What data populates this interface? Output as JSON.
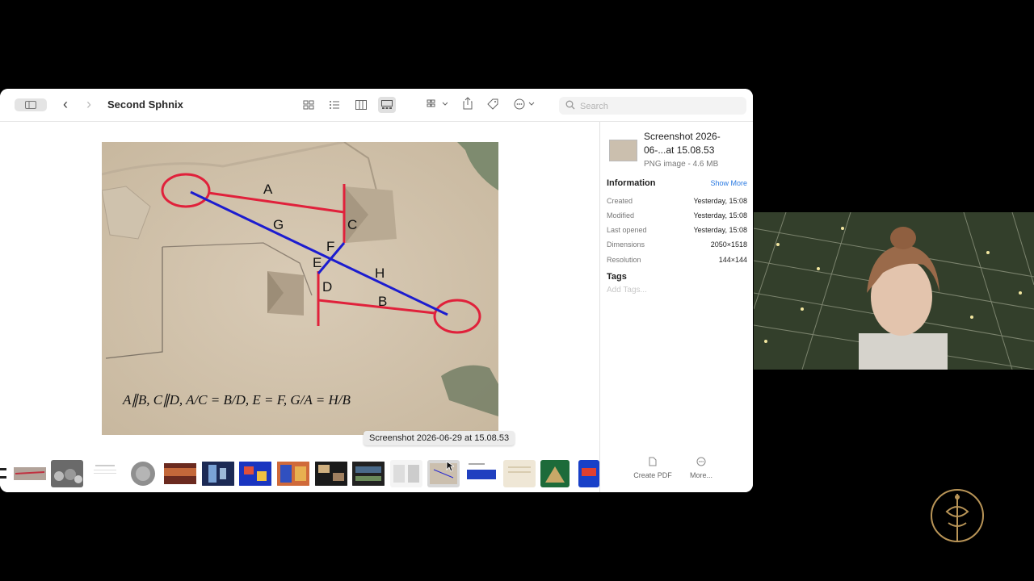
{
  "window": {
    "title": "Second Sphnix",
    "search_placeholder": "Search"
  },
  "preview": {
    "labels": [
      "A",
      "G",
      "C",
      "F",
      "E",
      "H",
      "D",
      "B"
    ],
    "formula": "A∥B, C∥D, A/C = B/D, E = F, G/A = H/B"
  },
  "tooltip": "Screenshot 2026-06-29 at 15.08.53",
  "info": {
    "file_name": "Screenshot 2026-06-...at 15.08.53",
    "file_type": "PNG image - 4.6 MB",
    "section_title": "Information",
    "show_more": "Show More",
    "rows": [
      {
        "label": "Created",
        "value": "Yesterday, 15:08"
      },
      {
        "label": "Modified",
        "value": "Yesterday, 15:08"
      },
      {
        "label": "Last opened",
        "value": "Yesterday, 15:08"
      },
      {
        "label": "Dimensions",
        "value": "2050×1518"
      },
      {
        "label": "Resolution",
        "value": "144×144"
      }
    ],
    "tags_title": "Tags",
    "tags_placeholder": "Add Tags...",
    "actions": [
      {
        "label": "Create PDF",
        "icon": "document-icon"
      },
      {
        "label": "More...",
        "icon": "ellipsis-circle-icon"
      }
    ]
  },
  "colors": {
    "accent": "#2a7ae2",
    "red_mark": "#e0213b",
    "blue_mark": "#1c1ccf"
  }
}
